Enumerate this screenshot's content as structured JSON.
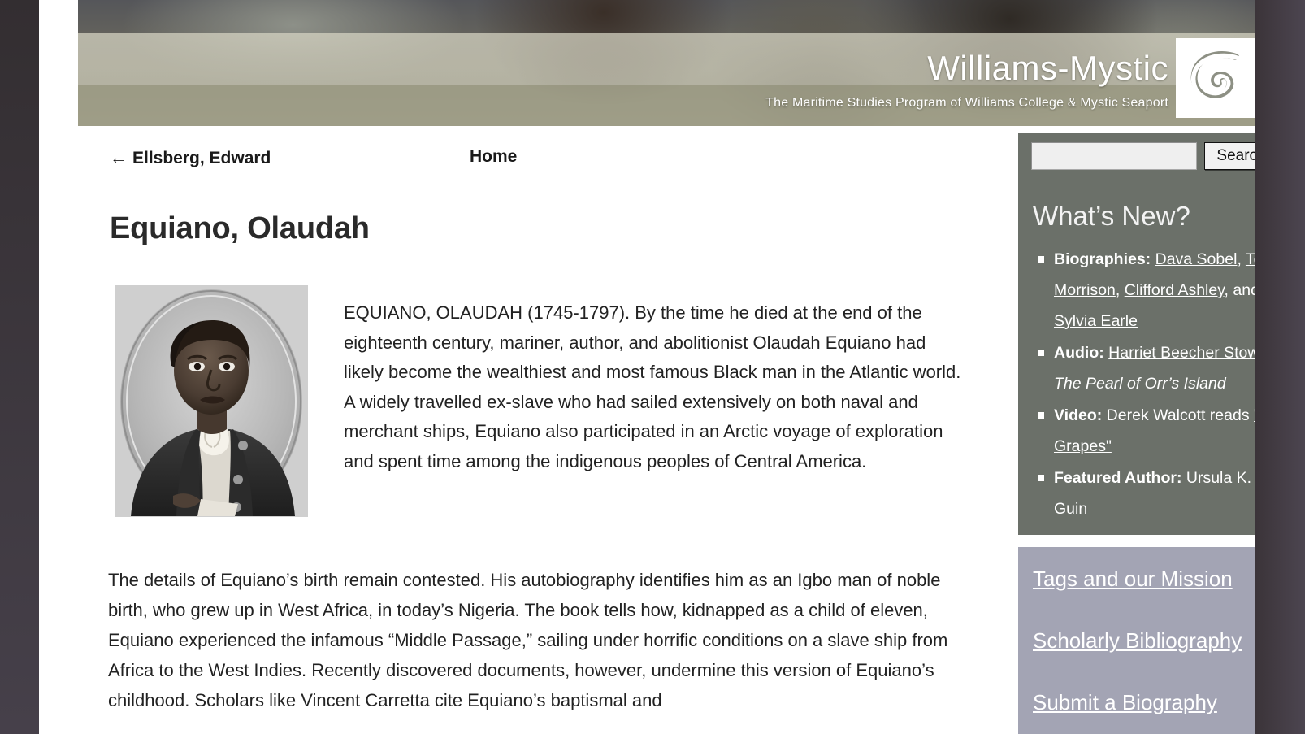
{
  "banner": {
    "title": "Williams-Mystic",
    "subtitle": "The Maritime Studies Program of Williams College & Mystic Seaport",
    "logo_icon": "spiral-nautilus-icon"
  },
  "nav": {
    "prev_arrow": "←",
    "prev_label": "Ellsberg, Edward",
    "home_label": "Home"
  },
  "main": {
    "page_title": "Equiano, Olaudah",
    "portrait_alt": "Engraved oval portrait of Olaudah Equiano",
    "lead_paragraph": "EQUIANO, OLAUDAH (1745-1797). By the time he died at the end of the eighteenth century, mariner, author, and abolitionist Olaudah Equiano had likely become the wealthiest and most famous Black man in the Atlantic world. A widely travelled ex-slave who had sailed extensively on both naval and merchant ships, Equiano also participated in an Arctic voyage of exploration and spent time among the indigenous peoples of Central America.",
    "body_paragraph": "The details of Equiano’s birth remain contested. His autobiography identifies him as an Igbo man of noble birth, who grew up in West Africa, in today’s Nigeria. The book tells how, kidnapped as a child of eleven, Equiano experienced the infamous “Middle Passage,” sailing under horrific conditions on a slave ship from Africa to the West Indies. Recently discovered documents, however, undermine this version of Equiano’s childhood. Scholars like Vincent Carretta cite Equiano’s baptismal and"
  },
  "search": {
    "value": "",
    "placeholder": "",
    "button_label": "Search"
  },
  "whats_new": {
    "heading": "What’s New?",
    "items": [
      {
        "label": "Biographies:",
        "links": [
          "Dava Sobel",
          "Toni Morrison",
          "Clifford Ashley",
          "Sylvia Earle"
        ],
        "separators": [
          ", ",
          ", ",
          ", and "
        ]
      },
      {
        "label": "Audio:",
        "link": "Harriet Beecher Stowe's",
        "italic_tail": "The Pearl of Orr’s Island"
      },
      {
        "label": "Video:",
        "plain": "Derek Walcott reads",
        "link": "\"Sea Grapes\""
      },
      {
        "label": "Featured Author:",
        "link": "Ursula K. Le Guin"
      }
    ]
  },
  "quick_links": {
    "items": [
      {
        "label": "Tags and our Mission"
      },
      {
        "label": "Scholarly Bibliography"
      },
      {
        "label": "Submit a Biography"
      }
    ]
  },
  "colors": {
    "sidebar_top_bg": "#6b7069",
    "sidebar_bottom_bg": "#a3a4b4",
    "banner_overlay": "#a3a18a",
    "text": "#222222",
    "link": "#ffffff"
  }
}
